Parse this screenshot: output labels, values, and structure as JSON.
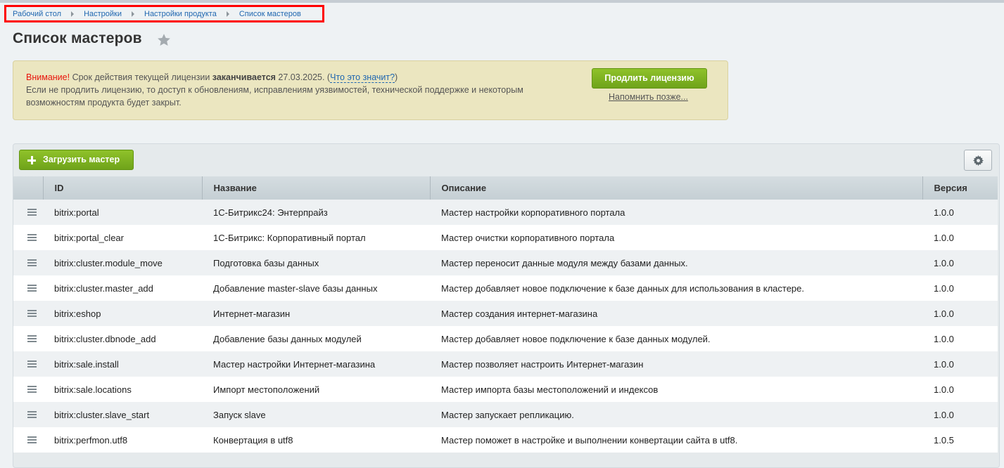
{
  "breadcrumb": [
    "Рабочий стол",
    "Настройки",
    "Настройки продукта",
    "Список мастеров"
  ],
  "page_title": "Список мастеров",
  "license": {
    "warning": "Внимание!",
    "text1": " Срок действия текущей лицензии ",
    "bold": "заканчивается",
    "date": " 27.03.2025. (",
    "link": "Что это значит?",
    "close_paren": ")",
    "text2": "Если не продлить лицензию, то доступ к обновлениям, исправлениям уязвимостей, технической поддержке и некоторым возможностям продукта будет закрыт.",
    "renew_label": "Продлить лицензию",
    "remind_label": "Напомнить позже..."
  },
  "toolbar": {
    "upload_label": "Загрузить мастер"
  },
  "columns": [
    "ID",
    "Название",
    "Описание",
    "Версия"
  ],
  "rows": [
    {
      "id": "bitrix:portal",
      "name": "1С-Битрикс24: Энтерпрайз",
      "desc": "Мастер настройки корпоративного портала",
      "version": "1.0.0"
    },
    {
      "id": "bitrix:portal_clear",
      "name": "1С-Битрикс: Корпоративный портал",
      "desc": "Мастер очистки корпоративного портала",
      "version": "1.0.0"
    },
    {
      "id": "bitrix:cluster.module_move",
      "name": "Подготовка базы данных",
      "desc": "Мастер переносит данные модуля между базами данных.",
      "version": "1.0.0"
    },
    {
      "id": "bitrix:cluster.master_add",
      "name": "Добавление master-slave базы данных",
      "desc": "Мастер добавляет новое подключение к базе данных для использования в кластере.",
      "version": "1.0.0"
    },
    {
      "id": "bitrix:eshop",
      "name": "Интернет-магазин",
      "desc": "Мастер создания интернет-магазина",
      "version": "1.0.0"
    },
    {
      "id": "bitrix:cluster.dbnode_add",
      "name": "Добавление базы данных модулей",
      "desc": "Мастер добавляет новое подключение к базе данных модулей.",
      "version": "1.0.0"
    },
    {
      "id": "bitrix:sale.install",
      "name": "Мастер настройки Интернет-магазина",
      "desc": "Мастер позволяет настроить Интернет-магазин",
      "version": "1.0.0"
    },
    {
      "id": "bitrix:sale.locations",
      "name": "Импорт местоположений",
      "desc": "Мастер импорта базы местоположений и индексов",
      "version": "1.0.0"
    },
    {
      "id": "bitrix:cluster.slave_start",
      "name": "Запуск slave",
      "desc": "Мастер запускает репликацию.",
      "version": "1.0.0"
    },
    {
      "id": "bitrix:perfmon.utf8",
      "name": "Конвертация в utf8",
      "desc": "Мастер поможет в настройке и выполнении конвертации сайта в utf8.",
      "version": "1.0.5"
    }
  ]
}
